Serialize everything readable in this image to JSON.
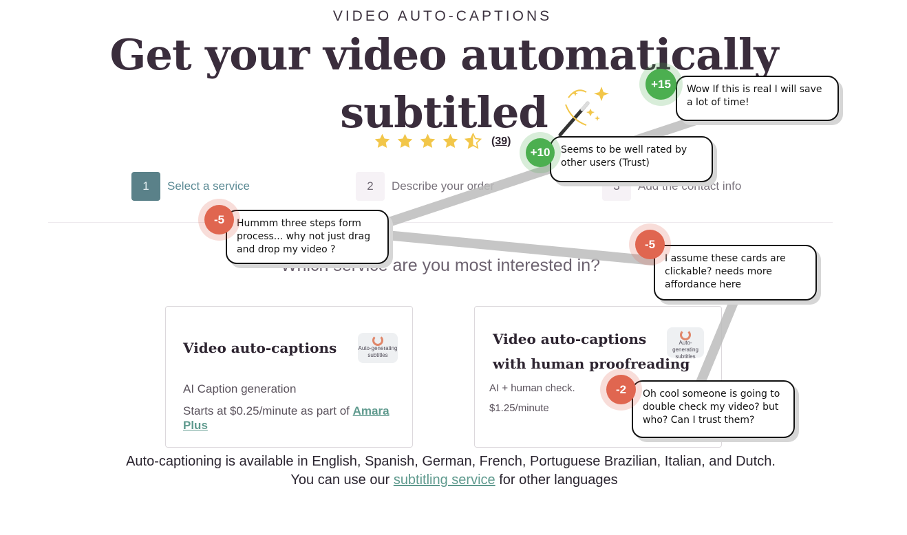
{
  "header": {
    "eyebrow": "VIDEO AUTO-CAPTIONS",
    "headline_line1": "Get your video automatically",
    "headline_line2": "subtitled",
    "wand_icon": "magic-wand-icon"
  },
  "rating": {
    "stars": 4.5,
    "max_stars": 5,
    "count_label": "(39)",
    "star_color": "#f2c649"
  },
  "steps": [
    {
      "number": "1",
      "label": "Select a service"
    },
    {
      "number": "2",
      "label": "Describe your order"
    },
    {
      "number": "3",
      "label": "Add the contact info"
    }
  ],
  "question": "Which service are you most interested in?",
  "cards": [
    {
      "title_line1": "Video auto-captions",
      "title_line2": "",
      "description": "AI Caption generation",
      "price_text": "Starts at $0.25/minute as part of",
      "price_link": "Amara Plus",
      "thumb_label": "Auto-generating subtitles"
    },
    {
      "title_line1": "Video auto-captions",
      "title_line2": "with human proofreading",
      "description": "AI + human check.",
      "price_text": "$1.25/minute",
      "price_link": "",
      "thumb_label": "Auto-generating subtitles"
    }
  ],
  "footer": {
    "line1": "Auto-captioning is available in English, Spanish, German, French, Portuguese Brazilian, Italian, and Dutch.",
    "line2_prefix": "You can use our",
    "line2_link": "subtitling service",
    "line2_suffix": "for other languages"
  },
  "annotations": [
    {
      "score": "+15",
      "text": "Wow If this is real I will save a lot of time!"
    },
    {
      "score": "+10",
      "text": "Seems to be well rated by other users (Trust)"
    },
    {
      "score": "-5",
      "text": "Hummm three steps form process... why not just drag and drop my video ?"
    },
    {
      "score": "-5",
      "text": "I assume these cards are clickable? needs more affordance here"
    },
    {
      "score": "-2",
      "text": "Oh cool someone is going to double check my video? but who? Can I trust them?"
    }
  ],
  "colors": {
    "accent_teal": "#5a8189",
    "link_green": "#5f9a8e",
    "positive": "#4caf50",
    "negative": "#e06650"
  }
}
